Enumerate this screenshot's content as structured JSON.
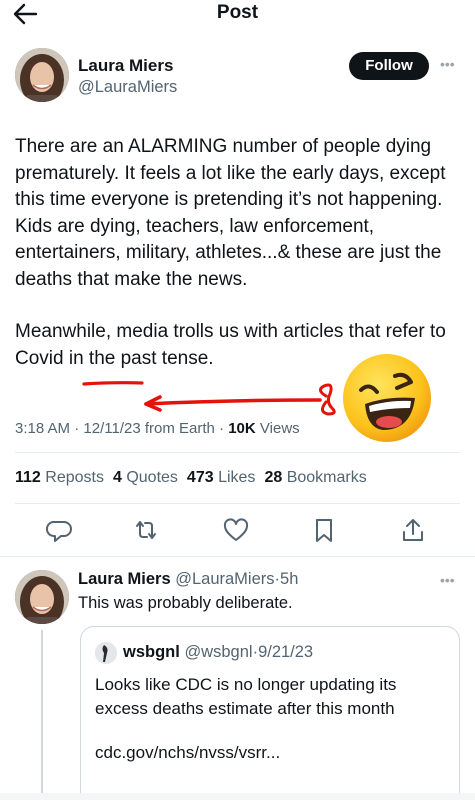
{
  "header": {
    "title": "Post",
    "back_icon": "arrow-left-icon"
  },
  "post": {
    "author": {
      "name": "Laura Miers",
      "handle": "@LauraMiers"
    },
    "follow_label": "Follow",
    "more_icon": "more-horizontal-icon",
    "paragraph1": "There are an ALARMING number of people dying prematurely. It feels a lot like the early days, except this time everyone is pretending it’s not happening. Kids are dying, teachers, law enforcement, entertainers, military, athletes...& these are just the deaths that make the news.",
    "paragraph2_prefix": "Meanwhile, media trolls us with articles that refer to ",
    "paragraph2_highlight": "Covid",
    "paragraph2_suffix": " in the past tense.",
    "meta": {
      "time": "3:18 AM",
      "date": "12/11/23",
      "source": "from Earth",
      "views_count": "10K",
      "views_label": "Views"
    },
    "stats": {
      "reposts_count": "112",
      "reposts_label": "Reposts",
      "quotes_count": "4",
      "quotes_label": "Quotes",
      "likes_count": "473",
      "likes_label": "Likes",
      "bookmarks_count": "28",
      "bookmarks_label": "Bookmarks"
    },
    "actions": [
      "reply-icon",
      "repost-icon",
      "like-icon",
      "bookmark-icon",
      "share-icon"
    ],
    "annotation": {
      "color": "#e3120b",
      "emoji": "😆"
    }
  },
  "reply": {
    "name": "Laura Miers",
    "handle": "@LauraMiers",
    "time": "5h",
    "text": "This was probably deliberate.",
    "quote": {
      "name": "wsbgnl",
      "handle": "@wsbgnl",
      "date": "9/21/23",
      "text": "Looks like CDC is no longer updating its excess deaths estimate after this month",
      "link": "cdc.gov/nchs/nvss/vsrr..."
    }
  },
  "colors": {
    "text": "#0f1419",
    "secondary": "#536471",
    "border": "#cfd9de",
    "follow_bg": "#0f1419"
  }
}
